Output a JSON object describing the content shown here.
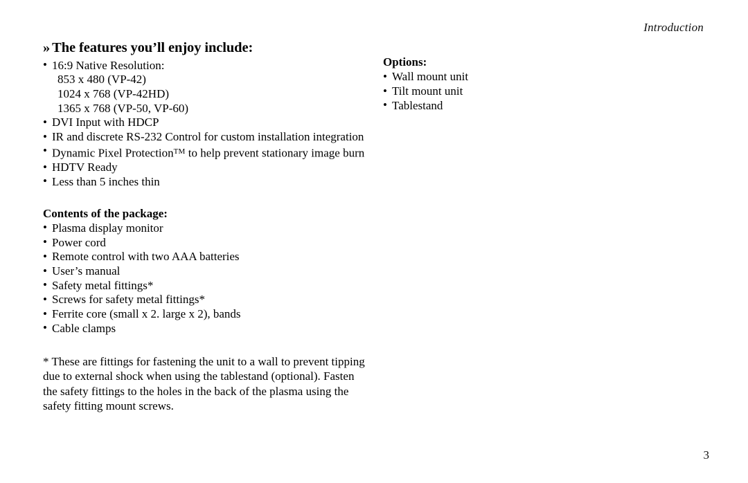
{
  "running_head": "Introduction",
  "page_number": "3",
  "features": {
    "guillemet": "»",
    "title": "The features you’ll enjoy include:",
    "items": [
      {
        "text": "16:9 Native Resolution:",
        "bulleted": true
      },
      {
        "text": "853 x 480 (VP-42)",
        "bulleted": false
      },
      {
        "text": "1024 x 768 (VP-42HD)",
        "bulleted": false
      },
      {
        "text": "1365 x 768 (VP-50, VP-60)",
        "bulleted": false
      },
      {
        "text": "DVI Input with HDCP",
        "bulleted": true
      },
      {
        "text": "IR and discrete RS-232 Control for custom installation integration",
        "bulleted": true
      },
      {
        "text": "Dynamic Pixel Protection",
        "trademark": "TM",
        "text_after": " to help prevent stationary image burn",
        "bulleted": true
      },
      {
        "text": "HDTV Ready",
        "bulleted": true
      },
      {
        "text": "Less than 5 inches thin",
        "bulleted": true
      }
    ]
  },
  "package": {
    "title": "Contents of the package:",
    "items": [
      "Plasma display monitor",
      "Power cord",
      "Remote control with two AAA batteries",
      "User’s manual",
      "Safety metal fittings*",
      "Screws for safety metal fittings*",
      "Ferrite core (small x 2. large x 2), bands",
      "Cable clamps"
    ]
  },
  "footnote": "* These are fittings for fastening the unit to a wall to prevent tipping due to external shock when using the tablestand (optional). Fasten the safety fittings to the holes in the back of the plasma using the safety fitting mount screws.",
  "options": {
    "title": "Options:",
    "items": [
      "Wall mount unit",
      "Tilt mount unit",
      "Tablestand"
    ]
  }
}
